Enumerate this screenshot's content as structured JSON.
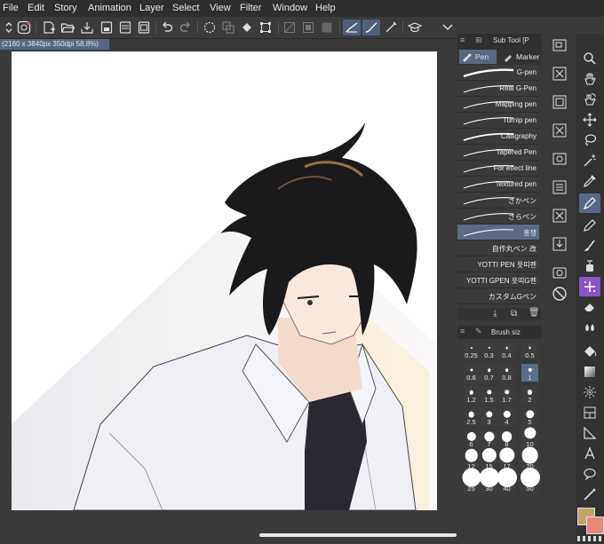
{
  "menubar": {
    "items": [
      "File",
      "Edit",
      "Story",
      "Animation",
      "Layer",
      "Select",
      "View",
      "Filter",
      "Window",
      "Help"
    ]
  },
  "status": {
    "canvas_info": "(2160 x 3840px 350dpi 58.8%)"
  },
  "subtool_panel": {
    "title": "Sub Tool [P",
    "tabs": [
      "Pen",
      "Marker"
    ],
    "brushes": [
      {
        "name": "G-pen"
      },
      {
        "name": "Real G-Pen"
      },
      {
        "name": "Mapping pen"
      },
      {
        "name": "Turnip pen"
      },
      {
        "name": "Calligraphy"
      },
      {
        "name": "Tapered Pen"
      },
      {
        "name": "For effect line"
      },
      {
        "name": "Textured pen"
      },
      {
        "name": "ざかペン"
      },
      {
        "name": "さらペン"
      },
      {
        "name": "홍쟁"
      },
      {
        "name": "自作丸ペン 改"
      },
      {
        "name": "YOTTI PEN 욧띠펜"
      },
      {
        "name": "YOTTI GPEN 욧띠G펜"
      },
      {
        "name": "カスタムGペン"
      }
    ],
    "selected_index": 10
  },
  "brush_size_panel": {
    "title": "Brush siz",
    "sizes": [
      "0.25",
      "0.3",
      "0.4",
      "0.5",
      "0.6",
      "0.7",
      "0.8",
      "1",
      "1.2",
      "1.5",
      "1.7",
      "2",
      "2.5",
      "3",
      "4",
      "5",
      "6",
      "7",
      "8",
      "10",
      "12",
      "15",
      "17",
      "20",
      "25",
      "30",
      "40",
      "50"
    ],
    "selected_value": "1"
  },
  "toolbox": {
    "tools": [
      "zoom",
      "hand",
      "rotate",
      "move",
      "lasso-select",
      "auto-select",
      "eyedropper",
      "pen",
      "pencil",
      "brush",
      "airbrush",
      "decoration",
      "eraser",
      "blend",
      "fill",
      "gradient",
      "figure",
      "frame",
      "ruler",
      "text",
      "balloon",
      "correct-line"
    ]
  },
  "colors": {
    "accent": "#586884",
    "main_color": "#c6a26b",
    "sub_color": "#e8887a"
  }
}
